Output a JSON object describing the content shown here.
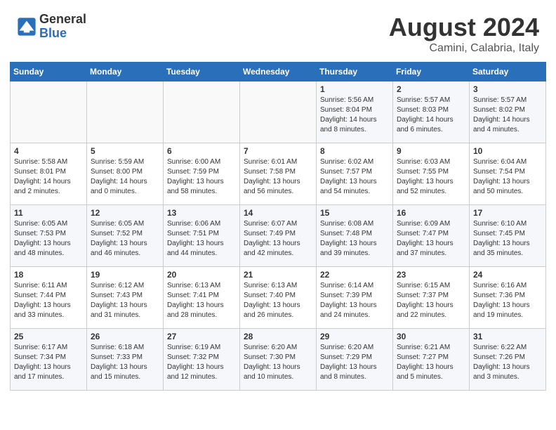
{
  "logo": {
    "line1": "General",
    "line2": "Blue"
  },
  "title": "August 2024",
  "location": "Camini, Calabria, Italy",
  "days_of_week": [
    "Sunday",
    "Monday",
    "Tuesday",
    "Wednesday",
    "Thursday",
    "Friday",
    "Saturday"
  ],
  "weeks": [
    [
      {
        "num": "",
        "sunrise": "",
        "sunset": "",
        "daylight": ""
      },
      {
        "num": "",
        "sunrise": "",
        "sunset": "",
        "daylight": ""
      },
      {
        "num": "",
        "sunrise": "",
        "sunset": "",
        "daylight": ""
      },
      {
        "num": "",
        "sunrise": "",
        "sunset": "",
        "daylight": ""
      },
      {
        "num": "1",
        "sunrise": "Sunrise: 5:56 AM",
        "sunset": "Sunset: 8:04 PM",
        "daylight": "Daylight: 14 hours and 8 minutes."
      },
      {
        "num": "2",
        "sunrise": "Sunrise: 5:57 AM",
        "sunset": "Sunset: 8:03 PM",
        "daylight": "Daylight: 14 hours and 6 minutes."
      },
      {
        "num": "3",
        "sunrise": "Sunrise: 5:57 AM",
        "sunset": "Sunset: 8:02 PM",
        "daylight": "Daylight: 14 hours and 4 minutes."
      }
    ],
    [
      {
        "num": "4",
        "sunrise": "Sunrise: 5:58 AM",
        "sunset": "Sunset: 8:01 PM",
        "daylight": "Daylight: 14 hours and 2 minutes."
      },
      {
        "num": "5",
        "sunrise": "Sunrise: 5:59 AM",
        "sunset": "Sunset: 8:00 PM",
        "daylight": "Daylight: 14 hours and 0 minutes."
      },
      {
        "num": "6",
        "sunrise": "Sunrise: 6:00 AM",
        "sunset": "Sunset: 7:59 PM",
        "daylight": "Daylight: 13 hours and 58 minutes."
      },
      {
        "num": "7",
        "sunrise": "Sunrise: 6:01 AM",
        "sunset": "Sunset: 7:58 PM",
        "daylight": "Daylight: 13 hours and 56 minutes."
      },
      {
        "num": "8",
        "sunrise": "Sunrise: 6:02 AM",
        "sunset": "Sunset: 7:57 PM",
        "daylight": "Daylight: 13 hours and 54 minutes."
      },
      {
        "num": "9",
        "sunrise": "Sunrise: 6:03 AM",
        "sunset": "Sunset: 7:55 PM",
        "daylight": "Daylight: 13 hours and 52 minutes."
      },
      {
        "num": "10",
        "sunrise": "Sunrise: 6:04 AM",
        "sunset": "Sunset: 7:54 PM",
        "daylight": "Daylight: 13 hours and 50 minutes."
      }
    ],
    [
      {
        "num": "11",
        "sunrise": "Sunrise: 6:05 AM",
        "sunset": "Sunset: 7:53 PM",
        "daylight": "Daylight: 13 hours and 48 minutes."
      },
      {
        "num": "12",
        "sunrise": "Sunrise: 6:05 AM",
        "sunset": "Sunset: 7:52 PM",
        "daylight": "Daylight: 13 hours and 46 minutes."
      },
      {
        "num": "13",
        "sunrise": "Sunrise: 6:06 AM",
        "sunset": "Sunset: 7:51 PM",
        "daylight": "Daylight: 13 hours and 44 minutes."
      },
      {
        "num": "14",
        "sunrise": "Sunrise: 6:07 AM",
        "sunset": "Sunset: 7:49 PM",
        "daylight": "Daylight: 13 hours and 42 minutes."
      },
      {
        "num": "15",
        "sunrise": "Sunrise: 6:08 AM",
        "sunset": "Sunset: 7:48 PM",
        "daylight": "Daylight: 13 hours and 39 minutes."
      },
      {
        "num": "16",
        "sunrise": "Sunrise: 6:09 AM",
        "sunset": "Sunset: 7:47 PM",
        "daylight": "Daylight: 13 hours and 37 minutes."
      },
      {
        "num": "17",
        "sunrise": "Sunrise: 6:10 AM",
        "sunset": "Sunset: 7:45 PM",
        "daylight": "Daylight: 13 hours and 35 minutes."
      }
    ],
    [
      {
        "num": "18",
        "sunrise": "Sunrise: 6:11 AM",
        "sunset": "Sunset: 7:44 PM",
        "daylight": "Daylight: 13 hours and 33 minutes."
      },
      {
        "num": "19",
        "sunrise": "Sunrise: 6:12 AM",
        "sunset": "Sunset: 7:43 PM",
        "daylight": "Daylight: 13 hours and 31 minutes."
      },
      {
        "num": "20",
        "sunrise": "Sunrise: 6:13 AM",
        "sunset": "Sunset: 7:41 PM",
        "daylight": "Daylight: 13 hours and 28 minutes."
      },
      {
        "num": "21",
        "sunrise": "Sunrise: 6:13 AM",
        "sunset": "Sunset: 7:40 PM",
        "daylight": "Daylight: 13 hours and 26 minutes."
      },
      {
        "num": "22",
        "sunrise": "Sunrise: 6:14 AM",
        "sunset": "Sunset: 7:39 PM",
        "daylight": "Daylight: 13 hours and 24 minutes."
      },
      {
        "num": "23",
        "sunrise": "Sunrise: 6:15 AM",
        "sunset": "Sunset: 7:37 PM",
        "daylight": "Daylight: 13 hours and 22 minutes."
      },
      {
        "num": "24",
        "sunrise": "Sunrise: 6:16 AM",
        "sunset": "Sunset: 7:36 PM",
        "daylight": "Daylight: 13 hours and 19 minutes."
      }
    ],
    [
      {
        "num": "25",
        "sunrise": "Sunrise: 6:17 AM",
        "sunset": "Sunset: 7:34 PM",
        "daylight": "Daylight: 13 hours and 17 minutes."
      },
      {
        "num": "26",
        "sunrise": "Sunrise: 6:18 AM",
        "sunset": "Sunset: 7:33 PM",
        "daylight": "Daylight: 13 hours and 15 minutes."
      },
      {
        "num": "27",
        "sunrise": "Sunrise: 6:19 AM",
        "sunset": "Sunset: 7:32 PM",
        "daylight": "Daylight: 13 hours and 12 minutes."
      },
      {
        "num": "28",
        "sunrise": "Sunrise: 6:20 AM",
        "sunset": "Sunset: 7:30 PM",
        "daylight": "Daylight: 13 hours and 10 minutes."
      },
      {
        "num": "29",
        "sunrise": "Sunrise: 6:20 AM",
        "sunset": "Sunset: 7:29 PM",
        "daylight": "Daylight: 13 hours and 8 minutes."
      },
      {
        "num": "30",
        "sunrise": "Sunrise: 6:21 AM",
        "sunset": "Sunset: 7:27 PM",
        "daylight": "Daylight: 13 hours and 5 minutes."
      },
      {
        "num": "31",
        "sunrise": "Sunrise: 6:22 AM",
        "sunset": "Sunset: 7:26 PM",
        "daylight": "Daylight: 13 hours and 3 minutes."
      }
    ]
  ]
}
